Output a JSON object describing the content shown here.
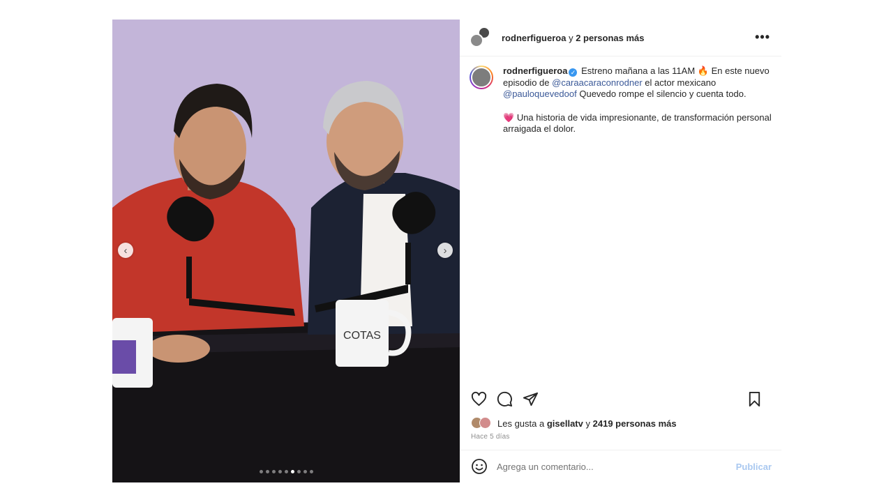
{
  "header": {
    "username": "rodnerfigueroa",
    "connector": "y",
    "others": "2 personas más",
    "more_icon": "more-horizontal-icon"
  },
  "media": {
    "prev_icon": "chevron-left-icon",
    "next_icon": "chevron-right-icon",
    "mug_text": "COTAS",
    "carousel_total": 9,
    "carousel_active_index": 5
  },
  "caption": {
    "username": "rodnerfigueroa",
    "verified_icon": "verified-badge-icon",
    "part1": "Estreno mañana a las 11AM",
    "fire_emoji": "🔥",
    "part2": "En este nuevo episodio de",
    "mention1": "@caraacaraconrodner",
    "part3": "el actor mexicano",
    "mention2": "@pauloquevedoof",
    "part4": "Quevedo rompe el silencio y cuenta todo.",
    "heart_emoji": "💗",
    "part5": "Una historia de vida impresionante, de transformación personal arraigada el dolor."
  },
  "actions": {
    "like_icon": "heart-icon",
    "comment_icon": "comment-icon",
    "share_icon": "send-icon",
    "save_icon": "bookmark-icon"
  },
  "likes": {
    "prefix": "Les gusta a",
    "user": "gisellatv",
    "connector": "y",
    "count": "2419 personas más"
  },
  "time": "Hace 5 días",
  "comment": {
    "emoji_icon": "emoji-smile-icon",
    "placeholder": "Agrega un comentario...",
    "publish_label": "Publicar"
  },
  "colors": {
    "link": "#3b5998",
    "verified": "#3897f0",
    "publish_disabled": "#a9c8f0",
    "backdrop": "#c2b4d8"
  }
}
